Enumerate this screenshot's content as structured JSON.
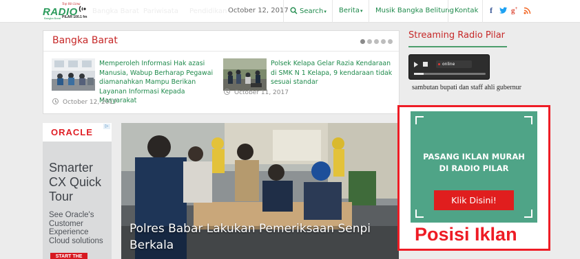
{
  "logo": {
    "text": "RADIO",
    "tagline": "Top Hit Lima",
    "frequency": "PILAR 100.1 fm",
    "subtitle": "Bangka Barat"
  },
  "nav": {
    "ghost_items": [
      "Bangka Barat",
      "Pariwisata",
      "Pendidikan"
    ],
    "date": "October 12, 2017",
    "search_label": "Search",
    "berita_label": "Berita",
    "musik_label": "Musik Bangka Belitung",
    "kontak_label": "Kontak"
  },
  "social": [
    {
      "icon": "facebook-icon",
      "glyph": "f",
      "color": "#3b5998"
    },
    {
      "icon": "twitter-icon",
      "glyph": "t",
      "color": "#1da1f2"
    },
    {
      "icon": "googleplus-icon",
      "glyph": "g+",
      "color": "#dd4b39"
    },
    {
      "icon": "rss-icon",
      "glyph": "rss",
      "color": "#f26522"
    }
  ],
  "bangka_barat": {
    "title": "Bangka Barat",
    "articles": [
      {
        "title": "Memperoleh Informasi Hak azasi Manusia, Wabup Berharap Pegawai diamanahkan Mampu Berikan Layanan Informasi Kepada Masyarakat",
        "date": "October 12, 2017"
      },
      {
        "title": "Polsek Kelapa Gelar Razia Kendaraan di SMK N 1 Kelapa, 9 kendaraan tidak sesuai standar",
        "date": "October 11, 2017"
      }
    ]
  },
  "oracle_ad": {
    "logo": "ORACLE",
    "headline": "Smarter CX Quick Tour",
    "body": "See Oracle's Customer Experience Cloud solutions",
    "button": "START THE TOUR"
  },
  "hero": {
    "caption": "Polres Babar Lakukan Pemeriksaan Senpi Berkala"
  },
  "streaming": {
    "title": "Streaming Radio Pilar",
    "player_status": "online",
    "caption": "sambutan bupati dan staff ahli gubernur"
  },
  "ad_box": {
    "headline_line1": "PASANG IKLAN MURAH",
    "headline_line2": "DI RADIO PILAR",
    "button": "Klik Disini!",
    "label": "Posisi Iklan"
  },
  "colors": {
    "accent_green": "#1f8a4c",
    "title_red": "#c62828",
    "ad_red": "#ee1c25",
    "ad_teal": "#4fa487"
  }
}
